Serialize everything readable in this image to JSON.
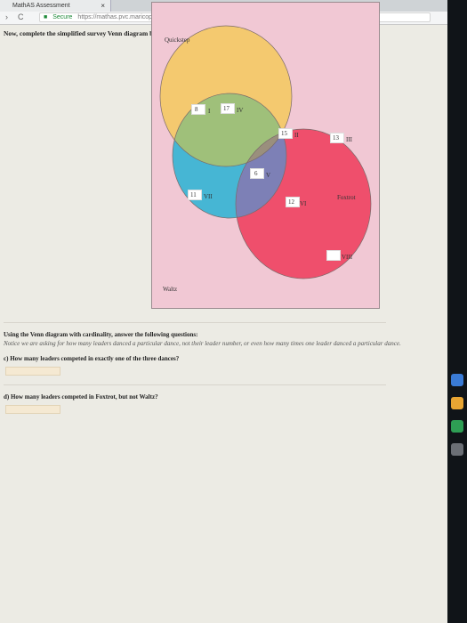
{
  "browser": {
    "tab_title": "MathAS Assessment",
    "tab_close": "×",
    "secure_label": "Secure",
    "url": "https://mathas.pvc.maricopa.edu/assessment/showtest.php"
  },
  "prompt": "Now, complete the simplified survey Venn diagram below, indicating only the cardinality of each region:",
  "venn": {
    "sets": [
      "Waltz",
      "Foxtrot",
      "Quickstep"
    ],
    "colors": {
      "waltz": "#f4c96f",
      "foxtrot": "#ef4f6c",
      "quickstep": "#46b6d4",
      "background": "#f1c8d4"
    },
    "regions": [
      {
        "label": "I",
        "value": "8"
      },
      {
        "label": "II",
        "value": "15"
      },
      {
        "label": "III",
        "value": "13"
      },
      {
        "label": "IV",
        "value": "17"
      },
      {
        "label": "V",
        "value": "6"
      },
      {
        "label": "VI",
        "value": "12"
      },
      {
        "label": "VII",
        "value": "11"
      },
      {
        "label": "VIII",
        "value": ""
      }
    ]
  },
  "questions": {
    "heading": "Using the Venn diagram with cardinality, answer the following questions:",
    "note": "Notice we are asking for how many leaders danced a particular dance, not their leader number, or even how many times one leader danced a particular dance.",
    "c": "c) How many leaders competed in exactly one of the three dances?",
    "d": "d) How many leaders competed in Foxtrot, but not Waltz?"
  }
}
